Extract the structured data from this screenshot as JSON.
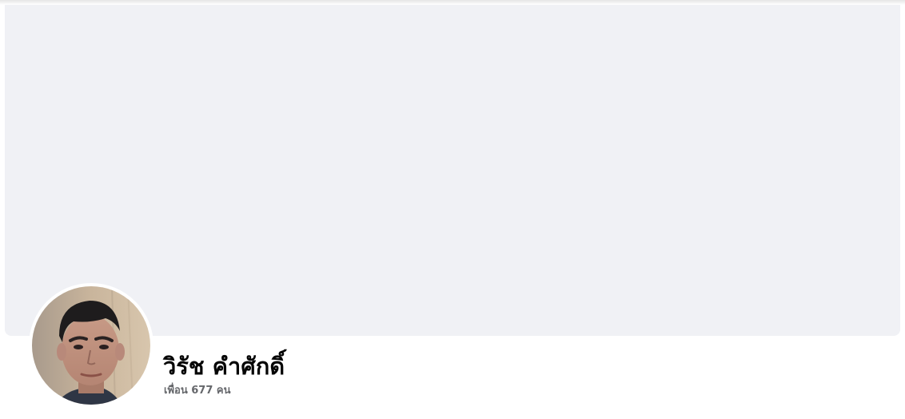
{
  "profile": {
    "name": "วิรัช คำศักดิ์",
    "friends_label": "เพื่อน 677 คน"
  },
  "colors": {
    "cover_background": "#f0f1f5",
    "name_text": "#050505",
    "secondary_text": "#65676b"
  }
}
